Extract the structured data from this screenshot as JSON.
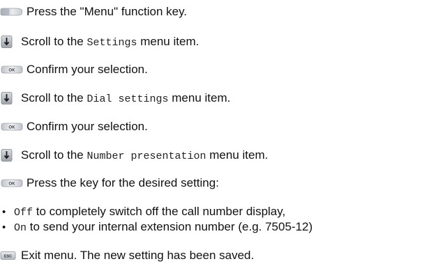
{
  "steps": [
    {
      "icon": "menu-key-icon",
      "parts": [
        {
          "text": "Press the \"Menu\" function key.",
          "mono": false
        }
      ]
    },
    {
      "icon": "scroll-down-key-icon",
      "parts": [
        {
          "text": "Scroll to the ",
          "mono": false
        },
        {
          "text": "Settings",
          "mono": true
        },
        {
          "text": " menu item.",
          "mono": false
        }
      ]
    },
    {
      "icon": "ok-key-icon",
      "label": "OK",
      "parts": [
        {
          "text": "Confirm your selection.",
          "mono": false
        }
      ]
    },
    {
      "icon": "scroll-down-key-icon",
      "parts": [
        {
          "text": "Scroll to the ",
          "mono": false
        },
        {
          "text": "Dial settings",
          "mono": true
        },
        {
          "text": " menu item.",
          "mono": false
        }
      ]
    },
    {
      "icon": "ok-key-icon",
      "label": "OK",
      "parts": [
        {
          "text": "Confirm your selection.",
          "mono": false
        }
      ]
    },
    {
      "icon": "scroll-down-key-icon",
      "parts": [
        {
          "text": "Scroll to the ",
          "mono": false
        },
        {
          "text": "Number presentation",
          "mono": true
        },
        {
          "text": " menu item.",
          "mono": false
        }
      ]
    },
    {
      "icon": "ok-key-icon",
      "label": "OK",
      "parts": [
        {
          "text": "Press the key for the desired setting:",
          "mono": false
        }
      ]
    }
  ],
  "options": [
    {
      "bullet": "•",
      "parts": [
        {
          "text": "Off",
          "mono": true
        },
        {
          "text": " to completely switch off the call number display,",
          "mono": false
        }
      ]
    },
    {
      "bullet": "•",
      "parts": [
        {
          "text": "On",
          "mono": true
        },
        {
          "text": " to send your internal extension number (e.g. 7505-12)",
          "mono": false
        }
      ]
    }
  ],
  "final_step": {
    "icon": "esc-key-icon",
    "label": "ESC",
    "parts": [
      {
        "text": "Exit menu. The new setting has been saved.",
        "mono": false
      }
    ]
  }
}
